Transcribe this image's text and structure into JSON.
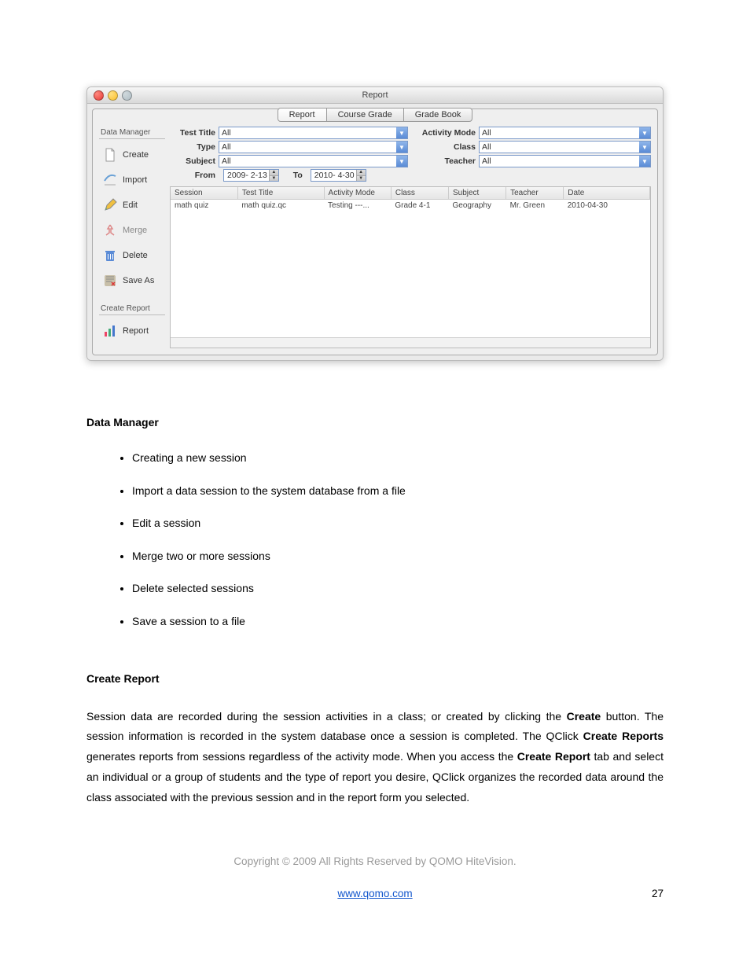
{
  "window": {
    "title": "Report",
    "tabs": {
      "report": "Report",
      "course_grade": "Course Grade",
      "grade_book": "Grade Book"
    },
    "sidebar": {
      "group1": "Data Manager",
      "create": "Create",
      "import": "Import",
      "edit": "Edit",
      "merge": "Merge",
      "delete": "Delete",
      "save_as": "Save As",
      "group2": "Create Report",
      "report": "Report"
    },
    "filters": {
      "test_title_label": "Test Title",
      "test_title_value": "All",
      "activity_mode_label": "Activity Mode",
      "activity_mode_value": "All",
      "type_label": "Type",
      "type_value": "All",
      "class_label": "Class",
      "class_value": "All",
      "subject_label": "Subject",
      "subject_value": "All",
      "teacher_label": "Teacher",
      "teacher_value": "All",
      "from_label": "From",
      "from_value": "2009- 2-13",
      "to_label": "To",
      "to_value": "2010- 4-30"
    },
    "table": {
      "headers": {
        "session": "Session",
        "test_title": "Test Title",
        "activity_mode": "Activity Mode",
        "class": "Class",
        "subject": "Subject",
        "teacher": "Teacher",
        "date": "Date"
      },
      "row1": {
        "session": "math quiz",
        "test_title": "math quiz.qc",
        "activity_mode": "Testing ---...",
        "class": "Grade 4-1",
        "subject": "Geography",
        "teacher": "Mr. Green",
        "date": "2010-04-30"
      }
    }
  },
  "doc": {
    "heading1": "Data Manager",
    "bullets": {
      "b1": "Creating a new session",
      "b2": "Import a data session to the system database from a file",
      "b3": "Edit a session",
      "b4": "Merge two or more sessions",
      "b5": "Delete selected sessions",
      "b6": "Save a session to a file"
    },
    "heading2": "Create Report",
    "para_parts": {
      "p1": "Session data are recorded during the session activities in a class; or created by clicking the ",
      "p1b": "Create",
      "p2": " button. The session information is recorded in the system database once a session is completed. The QClick ",
      "p2b": "Create Reports",
      "p3": " generates reports from sessions regardless of the activity mode. When you access the ",
      "p3b": "Create Report",
      "p4": " tab and select an individual or a group of students and the type of report you desire, QClick organizes the recorded data around the class associated with the previous session and in the report form you selected."
    },
    "copyright": "Copyright © 2009 All Rights Reserved by QOMO HiteVision.",
    "url": "www.qomo.com",
    "page_number": "27"
  }
}
